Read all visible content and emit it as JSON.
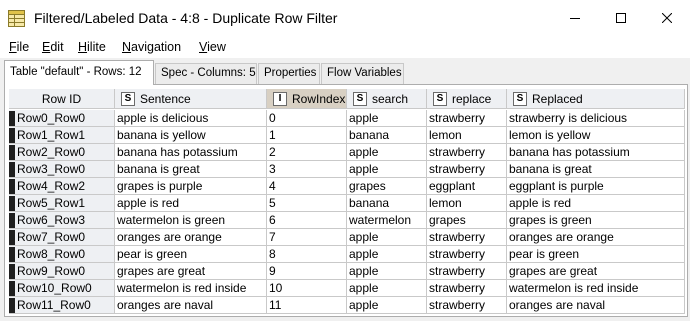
{
  "window": {
    "title": "Filtered/Labeled Data - 4:8 - Duplicate Row Filter",
    "icon": "knime-table-icon"
  },
  "menu": [
    "File",
    "Edit",
    "Hilite",
    "Navigation",
    "View"
  ],
  "tabs": [
    "Table \"default\" - Rows: 12",
    "Spec - Columns: 5",
    "Properties",
    "Flow Variables"
  ],
  "table": {
    "rowid_header": "Row ID",
    "columns": [
      {
        "type": "S",
        "name": "Sentence"
      },
      {
        "type": "I",
        "name": "RowIndex"
      },
      {
        "type": "S",
        "name": "search"
      },
      {
        "type": "S",
        "name": "replace"
      },
      {
        "type": "S",
        "name": "Replaced"
      }
    ],
    "rows": [
      {
        "id": "Row0_Row0",
        "cells": [
          "apple is delicious",
          "0",
          "apple",
          "strawberry",
          "strawberry is delicious"
        ]
      },
      {
        "id": "Row1_Row1",
        "cells": [
          "banana is yellow",
          "1",
          "banana",
          "lemon",
          "lemon is yellow"
        ]
      },
      {
        "id": "Row2_Row0",
        "cells": [
          "banana has potassium",
          "2",
          "apple",
          "strawberry",
          "banana has potassium"
        ]
      },
      {
        "id": "Row3_Row0",
        "cells": [
          "banana is great",
          "3",
          "apple",
          "strawberry",
          "banana is great"
        ]
      },
      {
        "id": "Row4_Row2",
        "cells": [
          "grapes is purple",
          "4",
          "grapes",
          "eggplant",
          "eggplant is purple"
        ]
      },
      {
        "id": "Row5_Row1",
        "cells": [
          "apple is red",
          "5",
          "banana",
          "lemon",
          "apple is red"
        ]
      },
      {
        "id": "Row6_Row3",
        "cells": [
          "watermelon is green",
          "6",
          "watermelon",
          "grapes",
          "grapes is green"
        ]
      },
      {
        "id": "Row7_Row0",
        "cells": [
          "oranges are orange",
          "7",
          "apple",
          "strawberry",
          "oranges are orange"
        ]
      },
      {
        "id": "Row8_Row0",
        "cells": [
          "pear is green",
          "8",
          "apple",
          "strawberry",
          "pear is green"
        ]
      },
      {
        "id": "Row9_Row0",
        "cells": [
          "grapes are great",
          "9",
          "apple",
          "strawberry",
          "grapes are great"
        ]
      },
      {
        "id": "Row10_Row0",
        "cells": [
          "watermelon is red inside",
          "10",
          "apple",
          "strawberry",
          "watermelon is red inside"
        ]
      },
      {
        "id": "Row11_Row0",
        "cells": [
          "oranges are naval",
          "11",
          "apple",
          "strawberry",
          "oranges are naval"
        ]
      }
    ]
  }
}
